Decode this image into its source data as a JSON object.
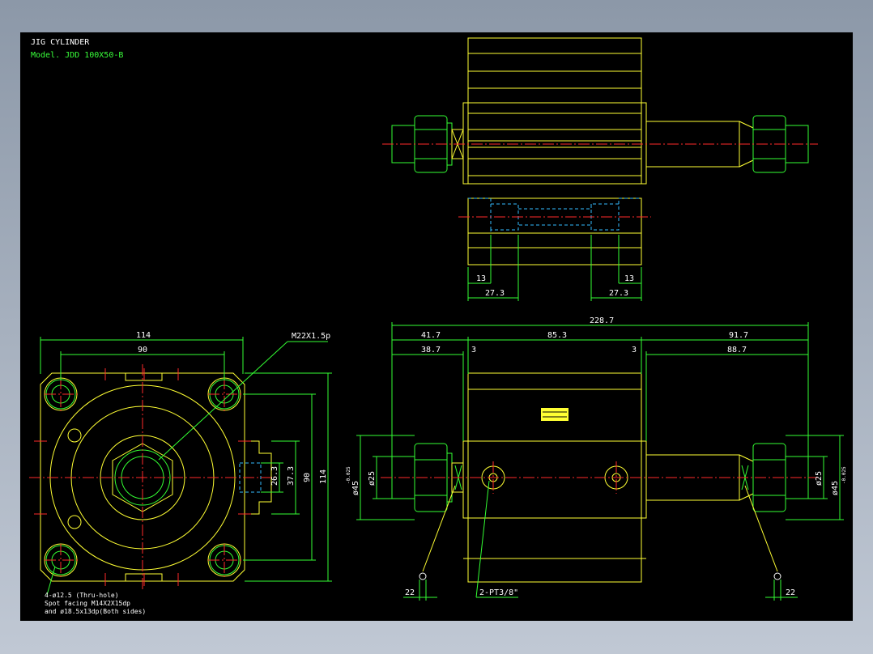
{
  "drawing": {
    "title": "JIG CYLINDER",
    "model": "Model. JDD 100X50-B"
  },
  "top_view": {
    "dim_left_13": "13",
    "dim_left_27": "27.3",
    "dim_right_13": "13",
    "dim_right_27": "27.3"
  },
  "front_view": {
    "dim_width": "114",
    "dim_holes": "90",
    "thread_note": "M22X1.5p",
    "dim_height": "114",
    "dim_hole_v": "90",
    "dim_37": "37.3",
    "dim_26": "26.3",
    "hole_note_1": "4-ø12.5 (Thru-hole)",
    "hole_note_2": "Spot facing  M14X2X15dp",
    "hole_note_3": "and ø18.5x13dp(Both sides)"
  },
  "side_view": {
    "dim_total": "228.7",
    "dim_41": "41.7",
    "dim_85": "85.3",
    "dim_91": "91.7",
    "dim_38": "38.7",
    "dim_3a": "3",
    "dim_3b": "3",
    "dim_88": "88.7",
    "dim_phi25_l": "ø25",
    "dim_phi45_l": "ø45",
    "dim_phi25_r": "ø25",
    "dim_phi45_r": "ø45",
    "tol_l": "-0.025",
    "tol_r": "-0.025",
    "dim_22_l": "22",
    "dim_22_r": "22",
    "port_note": "2-PT3/8\""
  },
  "colors": {
    "background": "#000000",
    "outline": "#ffff33",
    "dimension": "#33ff33",
    "centerline": "#ff2a2a",
    "hidden": "#33bbff",
    "text": "#ffffff"
  }
}
